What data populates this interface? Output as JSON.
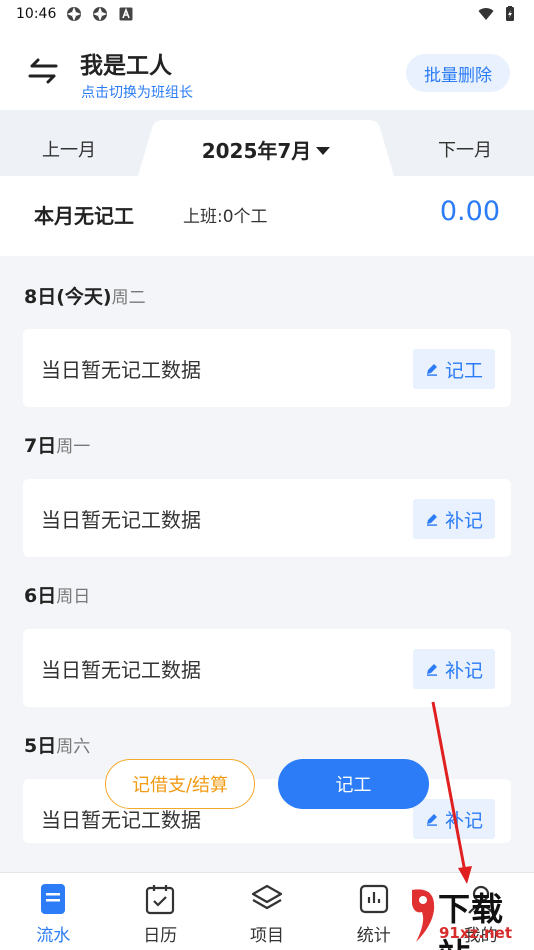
{
  "status": {
    "time": "10:46"
  },
  "header": {
    "title": "我是工人",
    "subtitle": "点击切换为班组长",
    "batch_delete": "批量删除"
  },
  "month": {
    "prev": "上一月",
    "current": "2025年7月",
    "next": "下一月"
  },
  "summary": {
    "title": "本月无记工",
    "work": "上班:0个工",
    "amount": "0.00"
  },
  "days": [
    {
      "day": "8日(今天)",
      "weekday": "周二",
      "text": "当日暂无记工数据",
      "action": "记工"
    },
    {
      "day": "7日",
      "weekday": "周一",
      "text": "当日暂无记工数据",
      "action": "补记"
    },
    {
      "day": "6日",
      "weekday": "周日",
      "text": "当日暂无记工数据",
      "action": "补记"
    },
    {
      "day": "5日",
      "weekday": "周六",
      "text": "当日暂无记工数据",
      "action": "补记"
    }
  ],
  "fab": {
    "loan": "记借支/结算",
    "record": "记工"
  },
  "nav": [
    {
      "label": "流水",
      "icon": "document-icon",
      "active": true
    },
    {
      "label": "日历",
      "icon": "calendar-icon",
      "active": false
    },
    {
      "label": "项目",
      "icon": "layers-icon",
      "active": false
    },
    {
      "label": "统计",
      "icon": "chart-icon",
      "active": false
    },
    {
      "label": "我的",
      "icon": "user-icon",
      "active": false
    }
  ],
  "watermark": {
    "text": "下载站",
    "url": "91xz.net"
  },
  "colors": {
    "accent": "#2b7cf6",
    "orange": "#f29b15",
    "background": "#f3f5f8"
  }
}
